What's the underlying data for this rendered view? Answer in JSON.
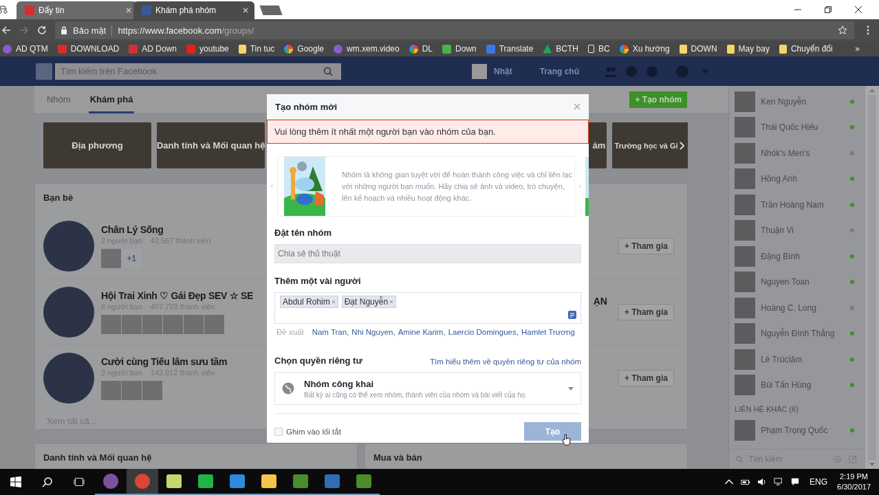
{
  "browser": {
    "tabs": [
      {
        "title": "Đẩy tin",
        "kind": "mail",
        "selected": false
      },
      {
        "title": "Khám phá nhóm",
        "kind": "social",
        "selected": true
      }
    ],
    "security_label": "Bảo mật",
    "url_host": "https://www.facebook.com",
    "url_path": "/groups/",
    "bookmarks": [
      {
        "label": "AD QTM",
        "kind": "circle"
      },
      {
        "label": "DOWNLOAD",
        "kind": "mail"
      },
      {
        "label": "AD Down",
        "kind": "mail"
      },
      {
        "label": "youtube",
        "kind": "video"
      },
      {
        "label": "Tin tuc",
        "kind": "folder"
      },
      {
        "label": "Google",
        "kind": "ring"
      },
      {
        "label": "wm.xem.video",
        "kind": "circle"
      },
      {
        "label": "DL",
        "kind": "ring"
      },
      {
        "label": "Down",
        "kind": "grid"
      },
      {
        "label": "Translate",
        "kind": "square"
      },
      {
        "label": "BCTH",
        "kind": "triangle"
      },
      {
        "label": "BC",
        "kind": "page"
      },
      {
        "label": "Xu hướng",
        "kind": "ring"
      },
      {
        "label": "DOWN",
        "kind": "folder"
      },
      {
        "label": "May bay",
        "kind": "folder"
      },
      {
        "label": "Chuyển đổi",
        "kind": "folder"
      }
    ],
    "bookmarks_overflow": "»"
  },
  "facebook_header": {
    "search_placeholder": "Tìm kiếm trên Facebook",
    "user_name": "Nhật",
    "home_link": "Trang chủ"
  },
  "groups_page": {
    "tabs": [
      {
        "label": "Nhóm",
        "selected": false
      },
      {
        "label": "Khám phá",
        "selected": true
      }
    ],
    "create_button": "+ Tạo nhóm",
    "categories": [
      {
        "label": "Địa phương"
      },
      {
        "label": "Danh tính và Mối quan hệ"
      },
      {
        "label": "ám"
      },
      {
        "label": "Trường học và Gi"
      }
    ],
    "friends_section": {
      "title": "Bạn bè",
      "groups": [
        {
          "name": "Chân Lý Sống",
          "friends": "2 người bạn",
          "members": "42.567 thành viên",
          "more": "+1",
          "join": "+ Tham gia"
        },
        {
          "name": "Hội Trai Xinh ♡ Gái Đẹp SEV ☆ SE",
          "name_tail": "ẠN",
          "friends": "6 người bạn",
          "members": "407.728 thành viên",
          "join": "+ Tham gia"
        },
        {
          "name": "Cười cùng Tiếu lâm sưu tầm",
          "friends": "3 người bạn",
          "members": "143.912 thành viên",
          "join": "+ Tham gia"
        }
      ],
      "see_all": "Xem tất cả..."
    },
    "bottom_sections": [
      "Danh tính và Mối quan hệ",
      "Mua và bán"
    ]
  },
  "chat_sidebar": {
    "contacts": [
      {
        "name": "Ken Nguyễn",
        "online": true
      },
      {
        "name": "Thái Quốc Hiếu",
        "online": true
      },
      {
        "name": "Nhók's Men's",
        "online": false
      },
      {
        "name": "Hồng Anh",
        "online": true
      },
      {
        "name": "Trần Hoàng Nam",
        "online": true
      },
      {
        "name": "Thuận Vi",
        "online": false
      },
      {
        "name": "Đặng Bình",
        "online": true
      },
      {
        "name": "Nguyen Toan",
        "online": true
      },
      {
        "name": "Hoàng C. Long",
        "online": false
      },
      {
        "name": "Nguyễn Đình Thắng",
        "online": true
      },
      {
        "name": "Lê Trúcìâm",
        "online": true
      },
      {
        "name": "Bùi Tấn Hùng",
        "online": true
      }
    ],
    "other_header": "LIÊN HỆ KHÁC (6)",
    "other_contacts": [
      {
        "name": "Phạm Trọng Quốc",
        "online": true
      }
    ],
    "search_placeholder": "Tìm kiếm"
  },
  "dialog": {
    "title": "Tạo nhóm mới",
    "error": "Vui lòng thêm ít nhất một người bạn vào nhóm của bạn.",
    "intro": "Nhóm là không gian tuyệt vời để hoàn thành công việc và chỉ liên lạc với những người bạn muốn. Hãy chia sẻ ảnh và video, trò chuyện, lên kế hoạch và nhiều hoạt động khác.",
    "name_label": "Đặt tên nhóm",
    "name_value": "Chia sẻ thủ thuật",
    "people_label": "Thêm một vài người",
    "people_tokens": [
      "Abdul Rohim",
      "Đạt Nguyễn"
    ],
    "suggest_label": "Đề xuất",
    "suggestions": [
      "Nam Tran,",
      "Nhi Nguyen,",
      "Amine Karim,",
      "Laercio Domingues,",
      "Hamlet Trương"
    ],
    "privacy_label": "Chọn quyền riêng tư",
    "privacy_link": "Tìm hiểu thêm về quyền riêng tư của nhóm",
    "privacy_option": "Nhóm công khai",
    "privacy_desc": "Bất kỳ ai cũng có thể xem nhóm, thành viên của nhóm và bài viết của họ.",
    "pin_label": "Ghim vào lối tắt",
    "pin_checked": false,
    "create_button": "Tạo",
    "create_disabled": true
  },
  "taskbar": {
    "apps": [
      {
        "kind": "viber",
        "selected": false
      },
      {
        "kind": "chrome",
        "selected": true
      },
      {
        "kind": "folder-green",
        "selected": false
      },
      {
        "kind": "sheets",
        "selected": false
      },
      {
        "kind": "writer",
        "selected": false
      },
      {
        "kind": "explorer",
        "selected": false
      },
      {
        "kind": "camtasia",
        "selected": false
      },
      {
        "kind": "pen",
        "selected": false
      },
      {
        "kind": "camtasia",
        "selected": false
      }
    ],
    "language": "ENG",
    "time": "2:19 PM",
    "date": "6/30/2017"
  }
}
